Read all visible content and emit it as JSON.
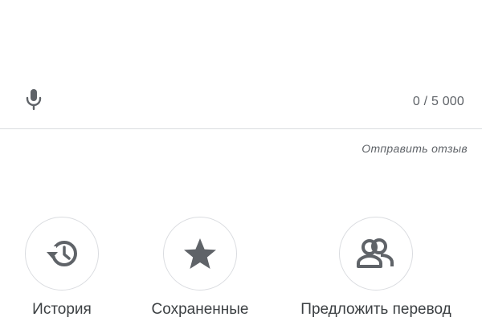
{
  "input": {
    "char_count": "0 / 5 000",
    "mic_icon": "mic-icon"
  },
  "feedback": {
    "label": "Отправить отзыв"
  },
  "actions": [
    {
      "label": "История",
      "icon": "history-icon"
    },
    {
      "label": "Сохраненные",
      "icon": "star-icon"
    },
    {
      "label": "Предложить перевод",
      "icon": "people-icon"
    }
  ],
  "colors": {
    "icon": "#5f6368",
    "text": "#3c4043",
    "divider": "#dadce0"
  }
}
